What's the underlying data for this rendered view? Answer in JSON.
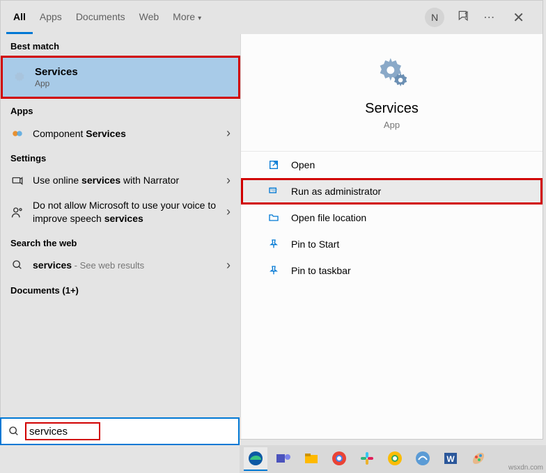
{
  "tabs": {
    "all": "All",
    "apps": "Apps",
    "documents": "Documents",
    "web": "Web",
    "more": "More"
  },
  "header": {
    "avatar_initial": "N"
  },
  "sections": {
    "best_match": "Best match",
    "apps": "Apps",
    "settings": "Settings",
    "search_web": "Search the web",
    "documents": "Documents (1+)"
  },
  "best_match_item": {
    "title": "Services",
    "sub": "App"
  },
  "apps_item": {
    "prefix": "Component ",
    "bold": "Services"
  },
  "settings_items": [
    {
      "pre": "Use online ",
      "bold": "services",
      "post": " with Narrator"
    },
    {
      "pre": "Do not allow Microsoft to use your voice to improve speech ",
      "bold": "services",
      "post": ""
    }
  ],
  "web_item": {
    "bold": "services",
    "suffix": " - See web results"
  },
  "detail": {
    "title": "Services",
    "sub": "App"
  },
  "actions": {
    "open": "Open",
    "run_admin": "Run as administrator",
    "open_location": "Open file location",
    "pin_start": "Pin to Start",
    "pin_taskbar": "Pin to taskbar"
  },
  "search": {
    "query": "services"
  },
  "watermark": "wsxdn.com"
}
